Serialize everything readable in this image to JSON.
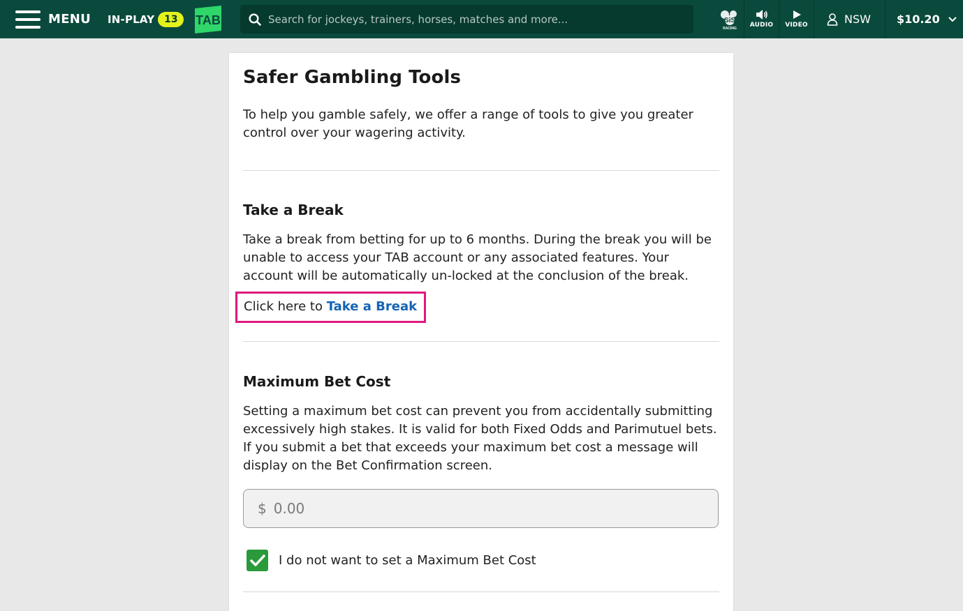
{
  "header": {
    "menu_label": "MENU",
    "inplay_label": "IN-PLAY",
    "inplay_count": "13",
    "logo_text": "TAB",
    "search_placeholder": "Search for jockeys, trainers, horses, matches and more...",
    "sis_text": "SiS",
    "sis_sub": "RACING",
    "audio_label": "AUDIO",
    "video_label": "VIDEO",
    "region": "NSW",
    "balance": "$10.20"
  },
  "colors": {
    "header_bg": "#0a4a3c",
    "badge": "#e5f21c",
    "logo_green": "#2fd66a",
    "link": "#1464b4",
    "highlight": "#e0187e",
    "checkbox": "#2a9a3a"
  },
  "page": {
    "title": "Safer Gambling Tools",
    "intro": "To help you gamble safely, we offer a range of tools to give you greater control over your wagering activity."
  },
  "take_a_break": {
    "title": "Take a Break",
    "body": "Take a break from betting for up to 6 months. During the break you will be unable to access your TAB account or any associated features. Your account will be automatically un-locked at the conclusion of the break.",
    "cta_prefix": "Click here to ",
    "cta_link": "Take a Break"
  },
  "max_bet": {
    "title": "Maximum Bet Cost",
    "body": "Setting a maximum bet cost can prevent you from accidentally submitting excessively high stakes. It is valid for both Fixed Odds and Parimutuel bets. If you submit a bet that exceeds your maximum bet cost a message will display on the Bet Confirmation screen.",
    "currency": "$",
    "amount_placeholder": "0.00",
    "checkbox_label": "I do not want to set a Maximum Bet Cost",
    "checkbox_checked": true
  }
}
